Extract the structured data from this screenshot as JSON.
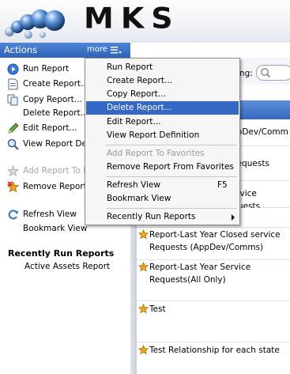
{
  "brand": {
    "logo_text": "MKS"
  },
  "actions_bar": {
    "title": "Actions",
    "more_label": "more"
  },
  "left_actions": [
    {
      "label": "Run Report",
      "icon": "run-icon",
      "disabled": false
    },
    {
      "label": "Create Report...",
      "icon": "new-report-icon",
      "disabled": false
    },
    {
      "label": "Copy Report...",
      "icon": "copy-report-icon",
      "disabled": false
    },
    {
      "label": "Delete Report...",
      "icon": "",
      "disabled": false
    },
    {
      "label": "Edit Report...",
      "icon": "pencil-icon",
      "disabled": false
    },
    {
      "label": "View Report Definition",
      "icon": "magnifier-icon",
      "disabled": false
    },
    {
      "label": "Add Report To Favorites",
      "icon": "star-disabled-icon",
      "disabled": true
    },
    {
      "label": "Remove Report From Favorites",
      "icon": "star-remove-icon",
      "disabled": false
    },
    {
      "label": "Refresh View",
      "icon": "refresh-icon",
      "disabled": false
    },
    {
      "label": "Bookmark View",
      "icon": "",
      "disabled": false
    }
  ],
  "recent": {
    "title": "Recently Run Reports",
    "items": [
      "Active Assets Report"
    ]
  },
  "search": {
    "label": "ing:"
  },
  "rows": [
    {
      "text": "ppDev/Comm",
      "starred": false
    },
    {
      "text": "e Requests",
      "starred": false
    },
    {
      "text": "l service Requests",
      "starred": false
    },
    {
      "text": "",
      "starred": false
    },
    {
      "text": "Report-Last Year Closed service Requests (AppDev/Comms)",
      "starred": true
    },
    {
      "text": "Report-Last Year Service Requests(All Only)",
      "starred": true
    },
    {
      "text": "Test",
      "starred": true
    },
    {
      "text": "Test Relationship for each state",
      "starred": true
    }
  ],
  "menu": {
    "items": [
      {
        "label": "Run Report",
        "shortcut": "",
        "selected": false,
        "disabled": false,
        "submenu": false
      },
      {
        "label": "Create Report...",
        "shortcut": "",
        "selected": false,
        "disabled": false,
        "submenu": false
      },
      {
        "label": "Copy Report...",
        "shortcut": "",
        "selected": false,
        "disabled": false,
        "submenu": false
      },
      {
        "label": "Delete Report...",
        "shortcut": "",
        "selected": true,
        "disabled": false,
        "submenu": false
      },
      {
        "label": "Edit Report...",
        "shortcut": "",
        "selected": false,
        "disabled": false,
        "submenu": false
      },
      {
        "label": "View Report Definition",
        "shortcut": "",
        "selected": false,
        "disabled": false,
        "submenu": false
      },
      {
        "label": "Add Report To Favorites",
        "shortcut": "",
        "selected": false,
        "disabled": true,
        "submenu": false
      },
      {
        "label": "Remove Report From Favorites",
        "shortcut": "",
        "selected": false,
        "disabled": false,
        "submenu": false
      },
      {
        "label": "Refresh View",
        "shortcut": "F5",
        "selected": false,
        "disabled": false,
        "submenu": false
      },
      {
        "label": "Bookmark View",
        "shortcut": "",
        "selected": false,
        "disabled": false,
        "submenu": false
      },
      {
        "label": "Recently Run Reports",
        "shortcut": "",
        "selected": false,
        "disabled": false,
        "submenu": true
      }
    ]
  },
  "colors": {
    "accent": "#3468c4",
    "header_blue": "#2f62b8",
    "star": "#f2a51a"
  }
}
